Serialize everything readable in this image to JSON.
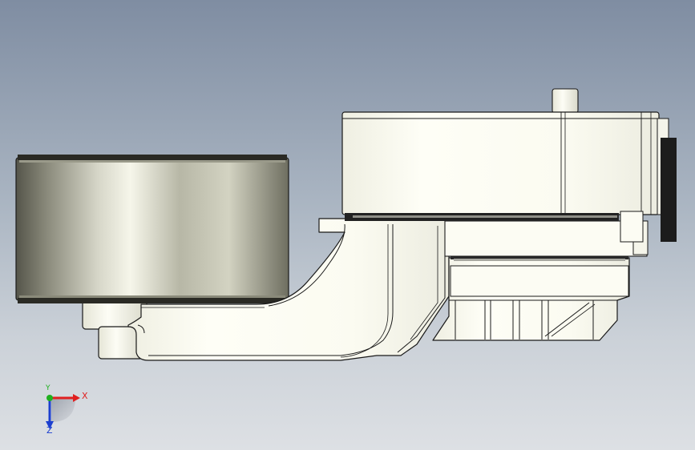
{
  "viewport": {
    "background_top": "#7f8da2",
    "background_bottom": "#dde0e4"
  },
  "model": {
    "part_fill": "#fbfbf2",
    "part_stroke": "#1a1a1a",
    "pulley_mid": "#f4f4e8",
    "pulley_dark": "#4d4d44",
    "belt_color": "#222222"
  },
  "triad": {
    "x_label": "X",
    "y_label": "Y",
    "z_label": "Z",
    "x_color": "#e02020",
    "y_color": "#1fb01f",
    "z_color": "#1c3fcf"
  }
}
